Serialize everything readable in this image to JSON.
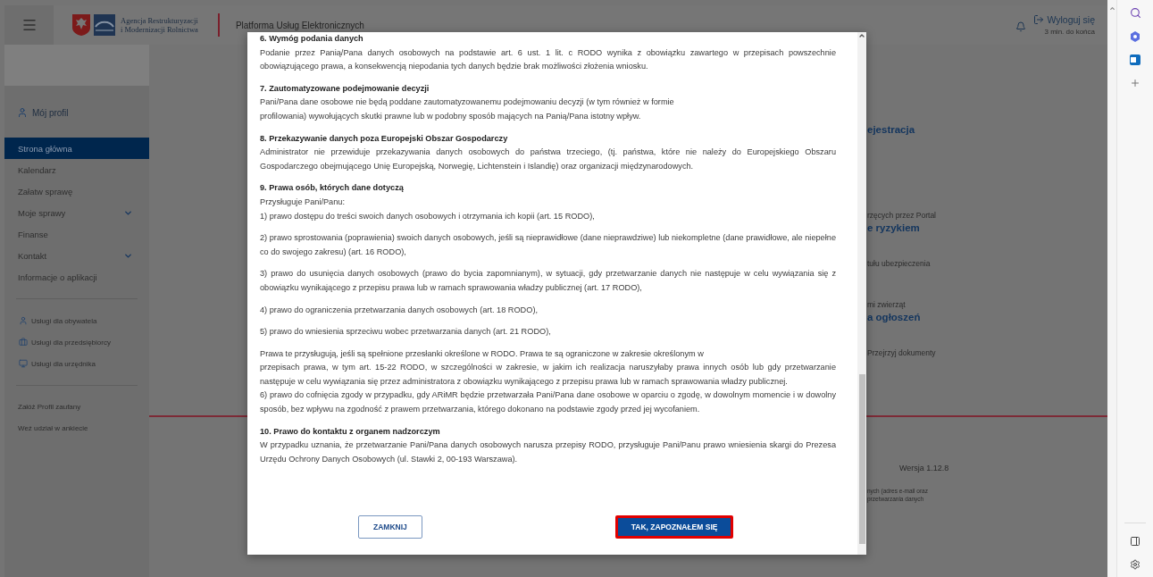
{
  "header": {
    "agency_name": [
      "Agencja Restrukturyzacji",
      "i Modernizacji Rolnictwa"
    ],
    "platform": "Platforma Usług Elektronicznych",
    "logout": "Wyloguj się",
    "session_timer": "3 min. do końca"
  },
  "sidebar": {
    "profile": "Mój profil",
    "nav": [
      {
        "label": "Strona główna",
        "selected": true,
        "expandable": false
      },
      {
        "label": "Kalendarz",
        "selected": false,
        "expandable": false
      },
      {
        "label": "Załatw sprawę",
        "selected": false,
        "expandable": false
      },
      {
        "label": "Moje sprawy",
        "selected": false,
        "expandable": true
      },
      {
        "label": "Finanse",
        "selected": false,
        "expandable": false
      },
      {
        "label": "Kontakt",
        "selected": false,
        "expandable": true
      },
      {
        "label": "Informacje o aplikacji",
        "selected": false,
        "expandable": false
      }
    ],
    "services": [
      {
        "label": "Usługi dla obywatela",
        "kind": "person"
      },
      {
        "label": "Usługi dla przedsiębiorcy",
        "kind": "business"
      },
      {
        "label": "Usługi dla urzędnika",
        "kind": "official"
      }
    ],
    "links": [
      "Załóż Profil zaufany",
      "Weź udział w ankiecie"
    ]
  },
  "background": {
    "fragments": [
      {
        "kind": "heading",
        "text": "ejestracja"
      },
      {
        "kind": "text",
        "text": "rzęcych przez Portal"
      },
      {
        "kind": "heading",
        "text": "e ryzykiem"
      },
      {
        "kind": "text",
        "text": "tułu ubezpieczenia"
      },
      {
        "kind": "text",
        "text": "mi zwierząt"
      },
      {
        "kind": "heading",
        "text": "a ogłoszeń"
      },
      {
        "kind": "text",
        "text": "Przejrzyj dokumenty"
      }
    ],
    "version": "Wersja 1.12.8",
    "footer_note": [
      "nych (adres e-mail oraz",
      "przetwarzania danych"
    ]
  },
  "modal": {
    "sections": [
      {
        "heading": "6.  Wymóg podania danych",
        "paragraphs": [
          [
            "Podanie przez Panią/Pana danych osobowych na podstawie art. 6 ust. 1 lit. c RODO wynika z obowiązku zawartego w przepisach powszechnie obowiązującego prawa, a konsekwencją niepodania tych danych będzie brak możliwości złożenia wniosku."
          ]
        ]
      },
      {
        "heading": "7.  Zautomatyzowane podejmowanie decyzji",
        "paragraphs": [
          [
            "Pani/Pana dane osobowe nie będą poddane zautomatyzowanemu podejmowaniu decyzji (w tym również w formie",
            "profilowania) wywołujących skutki prawne lub w podobny sposób mających na Panią/Pana istotny wpływ."
          ]
        ]
      },
      {
        "heading": "8.  Przekazywanie danych poza Europejski Obszar Gospodarczy",
        "paragraphs": [
          [
            "Administrator nie przewiduje przekazywania danych osobowych do państwa trzeciego, (tj. państwa, które nie należy do Europejskiego Obszaru Gospodarczego obejmującego Unię Europejską, Norwegię, Lichtenstein i Islandię) oraz organizacji międzynarodowych."
          ]
        ]
      },
      {
        "heading": "9.  Prawa osób, których dane dotyczą",
        "paragraphs": [
          [
            "Przysługuje Pani/Panu:",
            "1)    prawo dostępu do treści swoich danych osobowych i otrzymania ich kopii (art. 15 RODO),"
          ],
          [
            "2)      prawo sprostowania (poprawienia) swoich danych osobowych, jeśli są nieprawidłowe (dane nieprawdziwe) lub niekompletne (dane prawidłowe, ale niepełne co do swojego zakresu) (art. 16 RODO),"
          ],
          [
            "3)    prawo do usunięcia danych osobowych (prawo do bycia zapomnianym), w sytuacji, gdy przetwarzanie danych nie następuje w celu wywiązania się z obowiązku wynikającego z przepisu prawa lub w ramach sprawowania władzy publicznej (art. 17 RODO),"
          ],
          [
            "4)    prawo do ograniczenia przetwarzania danych osobowych (art. 18 RODO),"
          ],
          [
            "5)    prawo do wniesienia sprzeciwu wobec przetwarzania danych (art. 21 RODO),"
          ],
          [
            "Prawa te przysługują, jeśli są spełnione przesłanki określone w RODO. Prawa te są ograniczone w zakresie określonym w",
            "przepisach prawa, w tym art. 15-22 RODO, w szczególności w zakresie, w jakim ich realizacja naruszyłaby prawa innych osób lub gdy przetwarzanie następuje w celu wywiązania się przez administratora z obowiązku wynikającego z przepisu prawa lub w ramach sprawowania władzy publicznej.",
            "6) prawo do cofnięcia zgody w przypadku, gdy ARiMR będzie przetwarzała Pani/Pana dane osobowe w oparciu o zgodę, w dowolnym momencie i w dowolny sposób, bez wpływu na zgodność z prawem przetwarzania, którego dokonano na podstawie zgody przed jej wycofaniem."
          ]
        ]
      },
      {
        "heading": "10.     Prawo do kontaktu z organem nadzorczym",
        "paragraphs": [
          [
            "W przypadku uznania, że przetwarzanie Pani/Pana danych osobowych narusza przepisy RODO, przysługuje Pani/Panu prawo wniesienia skargi do Prezesa Urzędu Ochrony Danych Osobowych (ul. Stawki 2, 00-193 Warszawa)."
          ]
        ]
      }
    ],
    "buttons": [
      {
        "label": "ZAMKNIJ",
        "kind": "secondary",
        "focused": false
      },
      {
        "label": "TAK, ZAPOZNAŁEM SIĘ",
        "kind": "primary",
        "focused": true
      }
    ]
  }
}
